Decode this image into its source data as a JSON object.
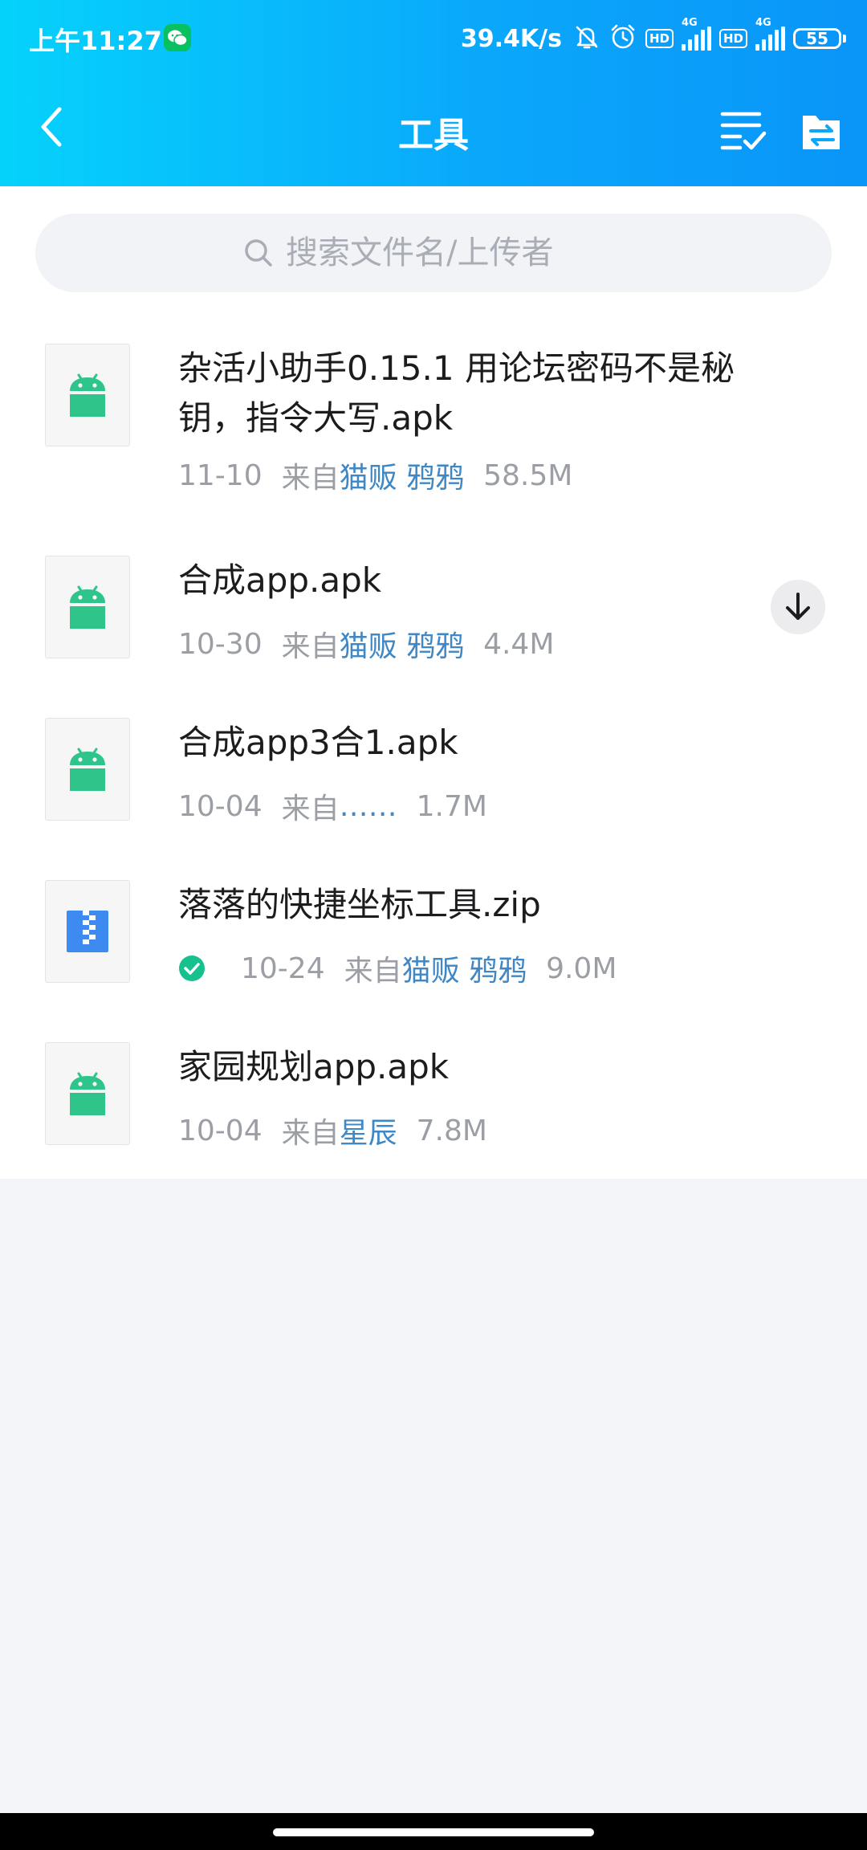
{
  "status_bar": {
    "time": "上午11:27",
    "net_speed": "39.4K/s",
    "hd_label": "HD",
    "network_type": "4G",
    "battery_level": "55",
    "icons": [
      "wechat-icon",
      "bell-off-icon",
      "alarm-icon",
      "signal-icon",
      "battery-icon"
    ]
  },
  "nav": {
    "title": "工具",
    "icons": [
      "back-arrow-icon",
      "multi-select-icon",
      "folder-transfer-icon"
    ]
  },
  "search": {
    "placeholder": "搜索文件名/上传者",
    "value": ""
  },
  "files": [
    {
      "name": "杂活小助手0.15.1 用论坛密码不是秘钥，指令大写.apk",
      "date": "11-10",
      "from_label": "来自",
      "uploader": "猫贩 鸦鸦",
      "size": "58.5M",
      "type_icon": "android-icon",
      "status": ""
    },
    {
      "name": "合成app.apk",
      "date": "10-30",
      "from_label": "来自",
      "uploader": "猫贩 鸦鸦",
      "size": "4.4M",
      "type_icon": "android-icon",
      "status": "download"
    },
    {
      "name": "合成app3合1.apk",
      "date": "10-04",
      "from_label": "来自",
      "uploader": "……",
      "size": "1.7M",
      "type_icon": "android-icon",
      "status": ""
    },
    {
      "name": "落落的快捷坐标工具.zip",
      "date": "10-24",
      "from_label": "来自",
      "uploader": "猫贩 鸦鸦",
      "size": "9.0M",
      "type_icon": "zip-icon",
      "status": "downloaded"
    },
    {
      "name": "家园规划app.apk",
      "date": "10-04",
      "from_label": "来自",
      "uploader": "星辰",
      "size": "7.8M",
      "type_icon": "android-icon",
      "status": ""
    }
  ],
  "colors": {
    "header_gradient_start": "#05d2fb",
    "header_gradient_end": "#0a95f8",
    "android_green": "#2fc48a",
    "zip_blue": "#3d8bf0",
    "uploader_link": "#3f87c5",
    "done_green": "#16c08f"
  }
}
